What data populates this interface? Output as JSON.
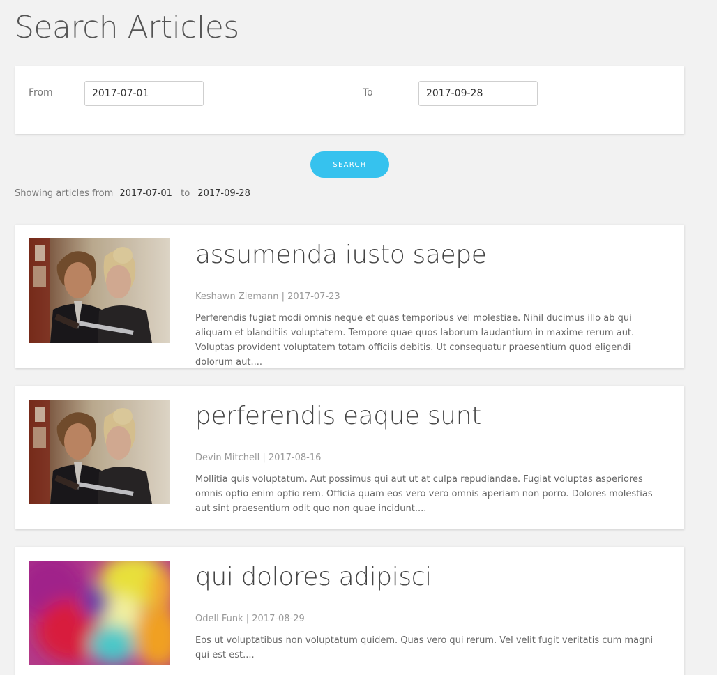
{
  "page": {
    "title": "Search Articles"
  },
  "filter": {
    "from_label": "From",
    "from_value": "2017-07-01",
    "to_label": "To",
    "to_value": "2017-09-28",
    "search_label": "SEARCH"
  },
  "summary": {
    "prefix": "Showing articles from",
    "from": "2017-07-01",
    "to_word": "to",
    "to": "2017-09-28"
  },
  "articles": [
    {
      "title": "assumenda iusto saepe",
      "meta": "Keshawn Ziemann | 2017-07-23",
      "excerpt": "Perferendis fugiat modi omnis neque et quas temporibus vel molestiae. Nihil ducimus illo ab qui aliquam et blanditiis voluptatem. Tempore quae quos laborum laudantium in maxime rerum aut. Voluptas provident voluptatem totam officiis debitis. Ut consequatur praesentium quod eligendi dolorum aut....",
      "image": "couple-with-knife-photo"
    },
    {
      "title": "perferendis eaque sunt",
      "meta": "Devin Mitchell | 2017-08-16",
      "excerpt": "Mollitia quis voluptatum. Aut possimus qui aut ut at culpa repudiandae. Fugiat voluptas asperiores omnis optio enim optio rem. Officia quam eos vero vero omnis aperiam non porro. Dolores molestias aut sint praesentium odit quo non quae incidunt....",
      "image": "couple-with-knife-photo"
    },
    {
      "title": "qui dolores adipisci",
      "meta": "Odell Funk | 2017-08-29",
      "excerpt": "Eos ut voluptatibus non voluptatum quidem. Quas vero qui rerum. Vel velit fugit veritatis cum magni qui est est....",
      "image": "abstract-colorful-blur"
    }
  ],
  "colors": {
    "accent": "#36c2ee",
    "background": "#f2f2f2",
    "card": "#ffffff"
  }
}
